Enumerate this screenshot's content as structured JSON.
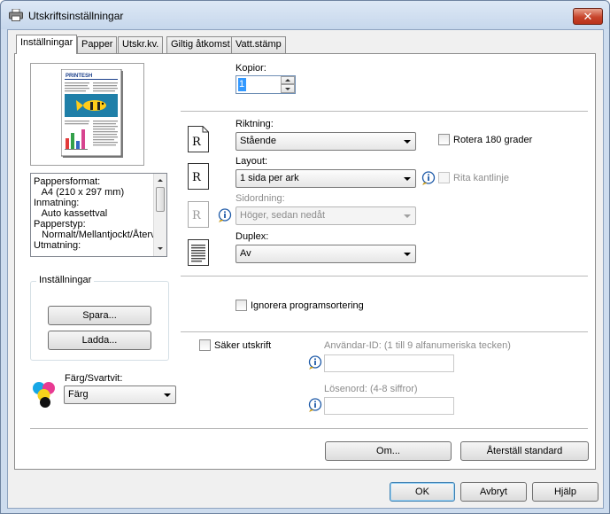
{
  "window": {
    "title": "Utskriftsinställningar",
    "close_symbol": "✕"
  },
  "tabs": [
    {
      "label": "Inställningar",
      "active": true
    },
    {
      "label": "Papper"
    },
    {
      "label": "Utskr.kv."
    },
    {
      "label": "Giltig åtkomst"
    },
    {
      "label": "Vatt.stämp"
    }
  ],
  "preview": {
    "masthead": "PRINTESH",
    "info_lines": [
      "Pappersformat:",
      "  A4 (210 x 297 mm)",
      "Inmatning:",
      "  Auto kassettval",
      "Papperstyp:",
      "  Normalt/Mellantjockt/Återv",
      "Utmatning:"
    ]
  },
  "copies": {
    "label": "Kopior:",
    "value": "1"
  },
  "orientation": {
    "label": "Riktning:",
    "value": "Stående",
    "icon_glyph": "R"
  },
  "rotate180": {
    "label": "Rotera 180 grader",
    "checked": false
  },
  "layout": {
    "label": "Layout:",
    "value": "1 sida per ark",
    "icon_glyph": "R"
  },
  "draw_border": {
    "label": "Rita kantlinje",
    "checked": false,
    "enabled": false
  },
  "page_order": {
    "label": "Sidordning:",
    "value": "Höger, sedan nedåt",
    "enabled": false,
    "icon_glyph": "R"
  },
  "duplex": {
    "label": "Duplex:",
    "value": "Av"
  },
  "settings_group": {
    "label": "Inställningar",
    "save_label": "Spara...",
    "load_label": "Ladda..."
  },
  "ignore_sorting": {
    "label": "Ignorera programsortering",
    "checked": false
  },
  "secure_print": {
    "label": "Säker utskrift",
    "checked": false,
    "user_id_label": "Användar-ID: (1 till 9 alfanumeriska tecken)",
    "user_id_value": "",
    "password_label": "Lösenord: (4-8 siffror)",
    "password_value": ""
  },
  "color_mode": {
    "label": "Färg/Svartvit:",
    "value": "Färg"
  },
  "about_label": "Om...",
  "reset_label": "Återställ standard",
  "dialog_buttons": {
    "ok": "OK",
    "cancel": "Avbryt",
    "help": "Hjälp"
  },
  "colors": {
    "accent": "#3c7fb1",
    "close_red": "#c7442b",
    "info_blue": "#1e5aa8"
  }
}
